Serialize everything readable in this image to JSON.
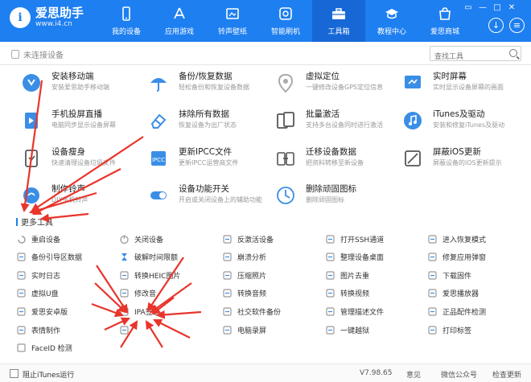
{
  "app": {
    "name": "爱思助手",
    "url": "www.i4.cn",
    "logo_letter": "i"
  },
  "nav": [
    {
      "label": "我的设备",
      "icon": "phone-icon"
    },
    {
      "label": "应用游戏",
      "icon": "app-store-icon"
    },
    {
      "label": "铃声壁纸",
      "icon": "ringtone-wallpaper-icon"
    },
    {
      "label": "智能刷机",
      "icon": "flash-icon"
    },
    {
      "label": "工具箱",
      "icon": "toolbox-icon",
      "active": true
    },
    {
      "label": "教程中心",
      "icon": "graduation-cap-icon"
    },
    {
      "label": "爱思商城",
      "icon": "shop-icon"
    }
  ],
  "window": {
    "controls": [
      "▭",
      "—",
      "□",
      "✕"
    ],
    "download_glyph": "↓",
    "menu_glyph": "≡"
  },
  "subbar": {
    "device_status": "未连接设备",
    "search_placeholder": "查找工具"
  },
  "tools": [
    {
      "title": "安装移动端",
      "desc": "安装爱思助手移动端",
      "icon": "install-mobile-icon",
      "color": "#3a8ee6"
    },
    {
      "title": "备份/恢复数据",
      "desc": "轻松备份和恢复设备数据",
      "icon": "backup-umbrella-icon",
      "color": "#3a8ee6"
    },
    {
      "title": "虚拟定位",
      "desc": "一键修改设备GPS定位信息",
      "icon": "location-pin-icon",
      "color": "#aaaaaa"
    },
    {
      "title": "实时屏幕",
      "desc": "实时显示设备屏幕的画面",
      "icon": "screen-icon",
      "color": "#3a8ee6"
    },
    {
      "title": "手机投屏直播",
      "desc": "电脑同步显示设备屏幕",
      "icon": "cast-screen-icon",
      "color": "#3a8ee6"
    },
    {
      "title": "抹除所有数据",
      "desc": "恢复设备为出厂状态",
      "icon": "eraser-icon",
      "color": "#3a8ee6"
    },
    {
      "title": "批量激活",
      "desc": "支持多台设备同时进行激活",
      "icon": "batch-activate-icon",
      "color": "#555555"
    },
    {
      "title": "iTunes及驱动",
      "desc": "安装和修复iTunes及驱动",
      "icon": "music-note-icon",
      "color": "#3a8ee6"
    },
    {
      "title": "设备瘦身",
      "desc": "快速清理设备垃圾文件",
      "icon": "device-slim-icon",
      "color": "#555555"
    },
    {
      "title": "更新IPCC文件",
      "desc": "更新IPCC运营商文件",
      "icon": "ipcc-file-icon",
      "color": "#3a8ee6"
    },
    {
      "title": "迁移设备数据",
      "desc": "把资料转移至新设备",
      "icon": "migrate-data-icon",
      "color": "#555555"
    },
    {
      "title": "屏蔽iOS更新",
      "desc": "屏蔽设备的iOS更新提示",
      "icon": "block-update-icon",
      "color": "#555555"
    },
    {
      "title": "制作铃声",
      "desc": "DIY手机铃声",
      "icon": "ringtone-maker-icon",
      "color": "#3a8ee6"
    },
    {
      "title": "设备功能开关",
      "desc": "开启或关闭设备上的辅助功能",
      "icon": "toggle-switch-icon",
      "color": "#3a8ee6"
    },
    {
      "title": "删除顽固图标",
      "desc": "删除顽固图标",
      "icon": "delete-icon-icon",
      "color": "#3a8ee6"
    }
  ],
  "more_tools_title": "更多工具",
  "mini_tools": [
    {
      "label": "重启设备",
      "icon": "restart-icon"
    },
    {
      "label": "关闭设备",
      "icon": "power-icon"
    },
    {
      "label": "反激活设备",
      "icon": "deactivate-icon"
    },
    {
      "label": "打开SSH通道",
      "icon": "ssh-terminal-icon"
    },
    {
      "label": "进入恢复模式",
      "icon": "recovery-mode-icon"
    },
    {
      "label": "备份引导区数据",
      "icon": "boot-backup-icon"
    },
    {
      "label": "破解时间限额",
      "icon": "hourglass-icon"
    },
    {
      "label": "崩溃分析",
      "icon": "crash-analysis-icon"
    },
    {
      "label": "整理设备桌面",
      "icon": "organize-desktop-icon"
    },
    {
      "label": "修复应用弹窗",
      "icon": "repair-popup-icon"
    },
    {
      "label": "实时日志",
      "icon": "log-icon"
    },
    {
      "label": "转换HEIC图片",
      "icon": "heic-convert-icon"
    },
    {
      "label": "压缩照片",
      "icon": "compress-photo-icon"
    },
    {
      "label": "图片去重",
      "icon": "dedupe-image-icon"
    },
    {
      "label": "下载固件",
      "icon": "download-firmware-icon"
    },
    {
      "label": "虚拟U盘",
      "icon": "usb-drive-icon"
    },
    {
      "label": "修改音",
      "icon": "edit-audio-icon"
    },
    {
      "label": "转换音频",
      "icon": "convert-audio-icon"
    },
    {
      "label": "转换视频",
      "icon": "convert-video-icon"
    },
    {
      "label": "爱思播放器",
      "icon": "player-icon"
    },
    {
      "label": "爱思安卓版",
      "icon": "android-icon"
    },
    {
      "label": "IPA签名",
      "icon": "ipa-sign-icon"
    },
    {
      "label": "社交软件备份",
      "icon": "social-backup-icon"
    },
    {
      "label": "管理描述文件",
      "icon": "profile-manage-icon"
    },
    {
      "label": "正品配件检测",
      "icon": "accessory-check-icon"
    },
    {
      "label": "表情制作",
      "icon": "emoji-maker-icon"
    },
    {
      "label": "",
      "icon": "hidden-tool-icon"
    },
    {
      "label": "电脑录屏",
      "icon": "screen-record-icon"
    },
    {
      "label": "一键越狱",
      "icon": "jailbreak-icon"
    },
    {
      "label": "打印标签",
      "icon": "print-label-icon"
    },
    {
      "label": "FaceID 检测",
      "icon": "faceid-icon"
    }
  ],
  "footer": {
    "checkbox_label": "阻止iTunes运行",
    "version": "V7.98.65",
    "link1": "意见",
    "link2": "微信公众号",
    "link3": "检查更新"
  },
  "colors": {
    "brand": "#1e7ff0",
    "arrow": "#e8352c"
  }
}
